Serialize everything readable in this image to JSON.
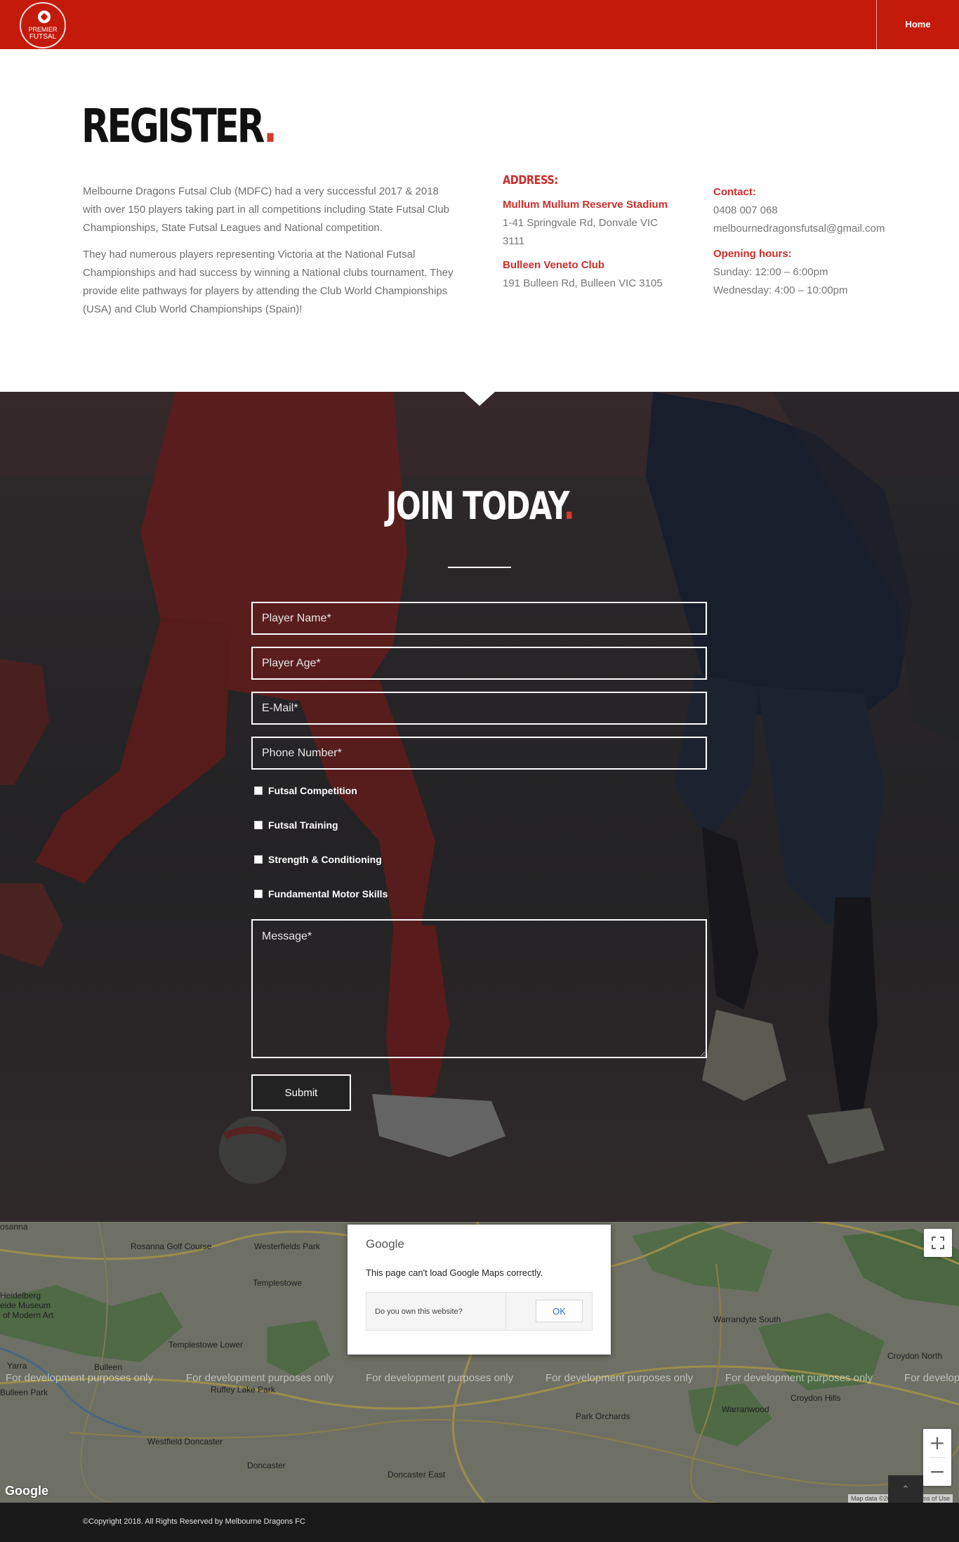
{
  "header": {
    "logo_line1": "PREMIER",
    "logo_line2": "FUTSAL",
    "nav_home": "Home"
  },
  "register": {
    "title": "REGISTER",
    "title_dot": ".",
    "paragraphs": [
      "Melbourne Dragons Futsal Club (MDFC) had a very successful 2017 & 2018 with over 150 players taking part in all competitions including State Futsal Club Championships, State Futsal Leagues and National competition.",
      "They had numerous players representing Victoria at the National Futsal Championships and had success by winning a National clubs tournament. They provide elite pathways for players by attending the Club World Championships (USA) and Club World Championships (Spain)!"
    ],
    "address": {
      "heading": "ADDRESS:",
      "venues": [
        {
          "name": "Mullum Mullum Reserve Stadium",
          "address": "1-41 Springvale Rd, Donvale VIC 3111"
        },
        {
          "name": "Bulleen Veneto Club",
          "address": "191 Bulleen Rd, Bulleen VIC 3105"
        }
      ]
    },
    "contact": {
      "label": "Contact:",
      "phone": "0408 007 068",
      "email": "melbournedragonsfutsal@gmail.com",
      "hours_label": "Opening hours:",
      "hours": [
        "Sunday: 12:00 – 6:00pm",
        "Wednesday: 4:00 – 10:00pm"
      ]
    }
  },
  "join": {
    "title": "JOIN TODAY",
    "title_dot": ".",
    "fields": {
      "player_name": "Player Name*",
      "player_age": "Player Age*",
      "email": "E-Mail*",
      "phone": "Phone Number*",
      "message": "Message*"
    },
    "checkboxes": [
      "Futsal Competition",
      "Futsal Training",
      "Strength & Conditioning",
      "Fundamental Motor Skills"
    ],
    "submit": "Submit"
  },
  "map": {
    "dialog": {
      "brand": "Google",
      "message": "This page can't load Google Maps correctly.",
      "question": "Do you own this website?",
      "ok": "OK"
    },
    "dev_notice": "For development purposes only",
    "places": [
      "Rosanna Golf Course",
      "Westerfields Park",
      "Templestowe",
      "Heidelberg",
      "eide Museum",
      "of Modern Art",
      "Templestowe Lower",
      "Bulleen",
      "Yarra",
      "Bulleen Park",
      "Ruffey Lake Park",
      "Warrandyte South",
      "Croydon North",
      "Croydon Hills",
      "Warranwood",
      "Park Orchards",
      "Westfield Doncaster",
      "Doncaster",
      "Doncaster East",
      "osanna"
    ],
    "google_logo": "Google",
    "attribution": "Map data ©2020",
    "terms": "Terms of Use"
  },
  "footer": {
    "copyright": "©Copyright 2018. All Rights Reserved by Melbourne Dragons FC"
  }
}
